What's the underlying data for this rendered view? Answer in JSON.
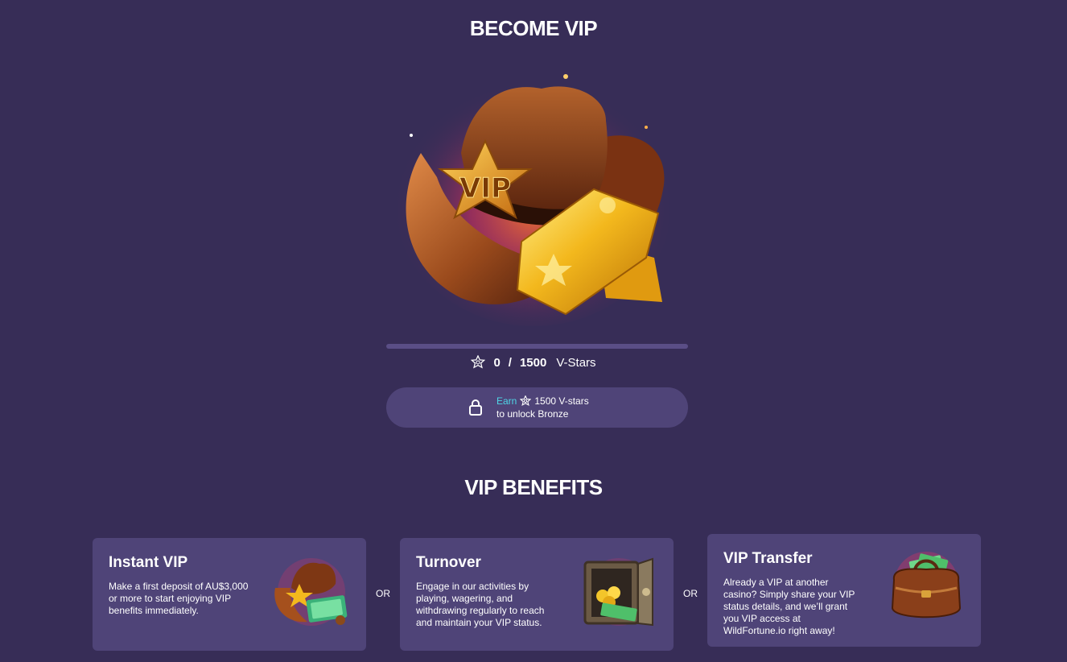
{
  "vip_section": {
    "title": "BECOME VIP",
    "progress": {
      "current": "0",
      "separator": "/",
      "target": "1500",
      "unit": "V-Stars",
      "fraction": 0
    },
    "unlock": {
      "earn_label": "Earn",
      "amount": "1500 V-stars",
      "subtext": "to unlock Bronze"
    }
  },
  "benefits": {
    "title": "VIP BENEFITS",
    "or_label": "OR",
    "cards": [
      {
        "title": "Instant VIP",
        "text": "Make a first deposit of AU$3,000 or more to start enjoying VIP benefits immediately.",
        "icon": "cowboy-hat-cash-icon"
      },
      {
        "title": "Turnover",
        "text": "Engage in our activities by playing, wagering, and withdrawing regularly to reach and maintain your VIP status.",
        "icon": "safe-vault-icon"
      },
      {
        "title": "VIP Transfer",
        "text": "Already a VIP at another casino? Simply share your VIP status details, and we’ll grant you VIP access at WildFortune.io right away!",
        "icon": "money-bag-icon"
      }
    ]
  },
  "hero_badge_text": "VIP",
  "colors": {
    "background": "#372d57",
    "card": "#4f4478",
    "accent_cyan": "#4fd6e6",
    "track": "#5a4e86"
  }
}
